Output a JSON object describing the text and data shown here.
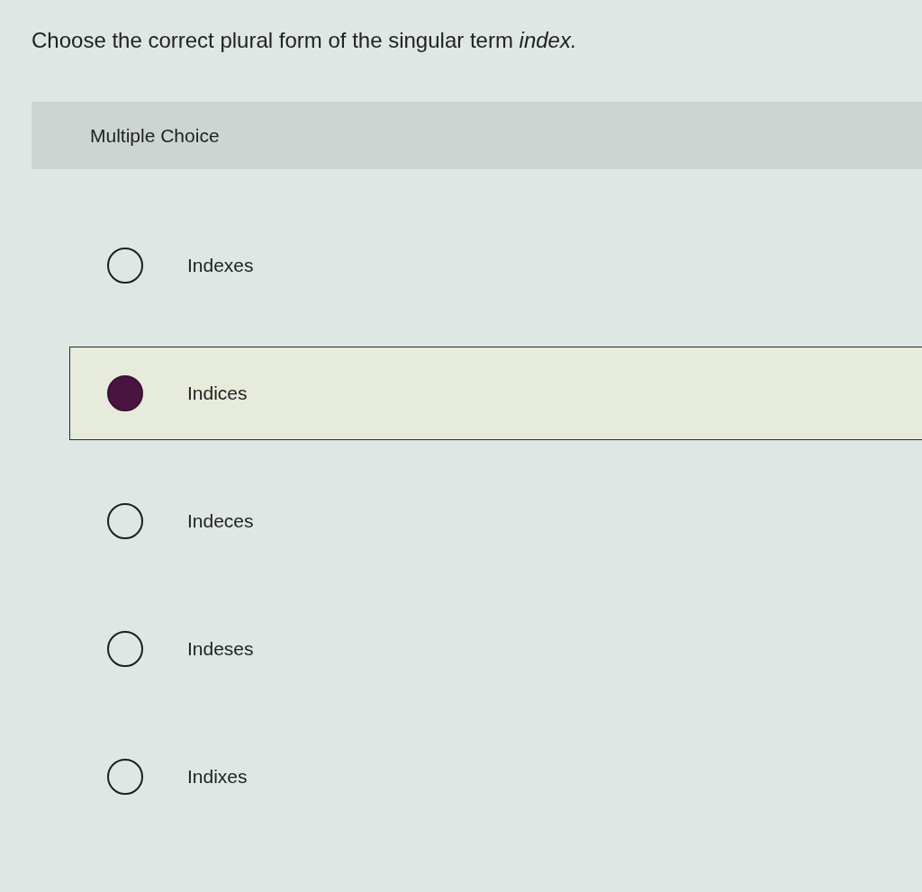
{
  "question": {
    "text": "Choose the correct plural form of the singular term *index.*"
  },
  "section": {
    "label": "Multiple Choice"
  },
  "options": [
    {
      "label": "Indexes",
      "selected": false
    },
    {
      "label": "Indices",
      "selected": true
    },
    {
      "label": "Indeces",
      "selected": false
    },
    {
      "label": "Indeses",
      "selected": false
    },
    {
      "label": "Indixes",
      "selected": false
    }
  ]
}
